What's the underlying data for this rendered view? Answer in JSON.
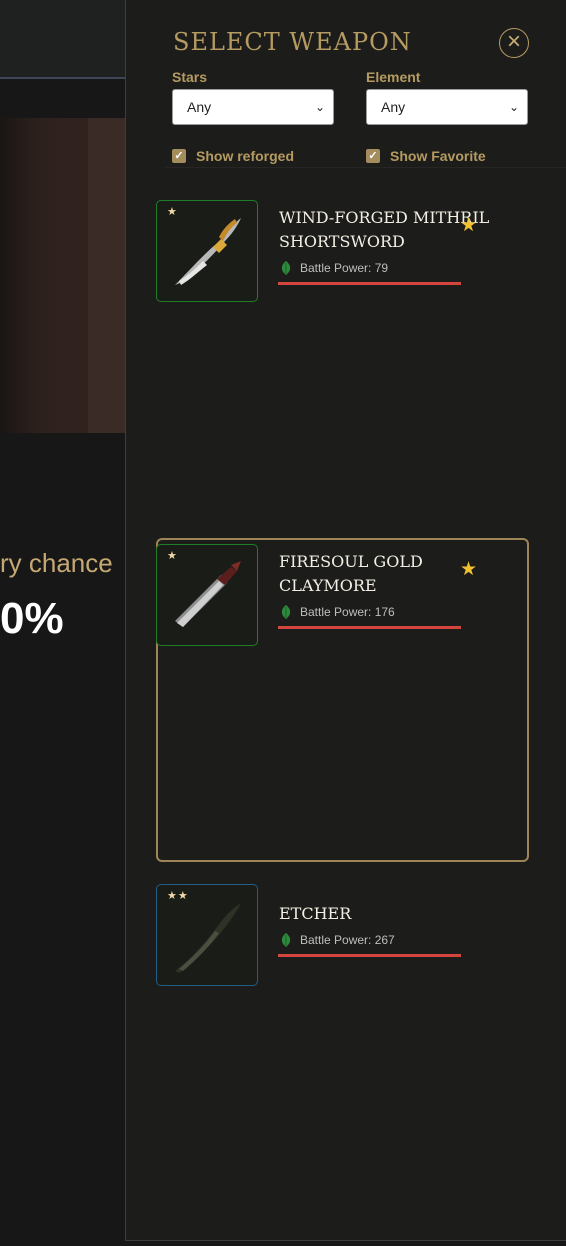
{
  "background": {
    "chance_text": "ry chance",
    "percent_text": "0%"
  },
  "panel": {
    "title": "SELECT WEAPON",
    "close_glyph": "×",
    "filters": {
      "stars": {
        "label": "Stars",
        "value": "Any"
      },
      "element": {
        "label": "Element",
        "value": "Any"
      },
      "show_reforged": {
        "label": "Show reforged",
        "checked": true
      },
      "show_favorite": {
        "label": "Show Favorite",
        "checked": true
      }
    },
    "weapons": [
      {
        "name": "Wind-Forged Mithril Shortsword",
        "stars": "★",
        "favorite": true,
        "battle_power": "Battle Power: 79",
        "rarity_color": "#1f7d28"
      },
      {
        "name": "Firesoul Gold Claymore",
        "stars": "★",
        "favorite": true,
        "battle_power": "Battle Power: 176",
        "rarity_color": "#1f7d28",
        "selected": true
      },
      {
        "name": "Etcher",
        "stars": "★★",
        "favorite": false,
        "battle_power": "Battle Power: 267",
        "rarity_color": "#245c84"
      }
    ]
  },
  "icons": {
    "favorite": "star-icon",
    "element": "leaf-icon",
    "close": "close-icon",
    "checkbox": "check-icon",
    "select": "chevron-down-icon"
  },
  "colors": {
    "accent_gold": "#b59a61",
    "favorite_star": "#f2c130",
    "battle_power_bar": "#d6443f",
    "leaf": "#2e8b3e"
  }
}
